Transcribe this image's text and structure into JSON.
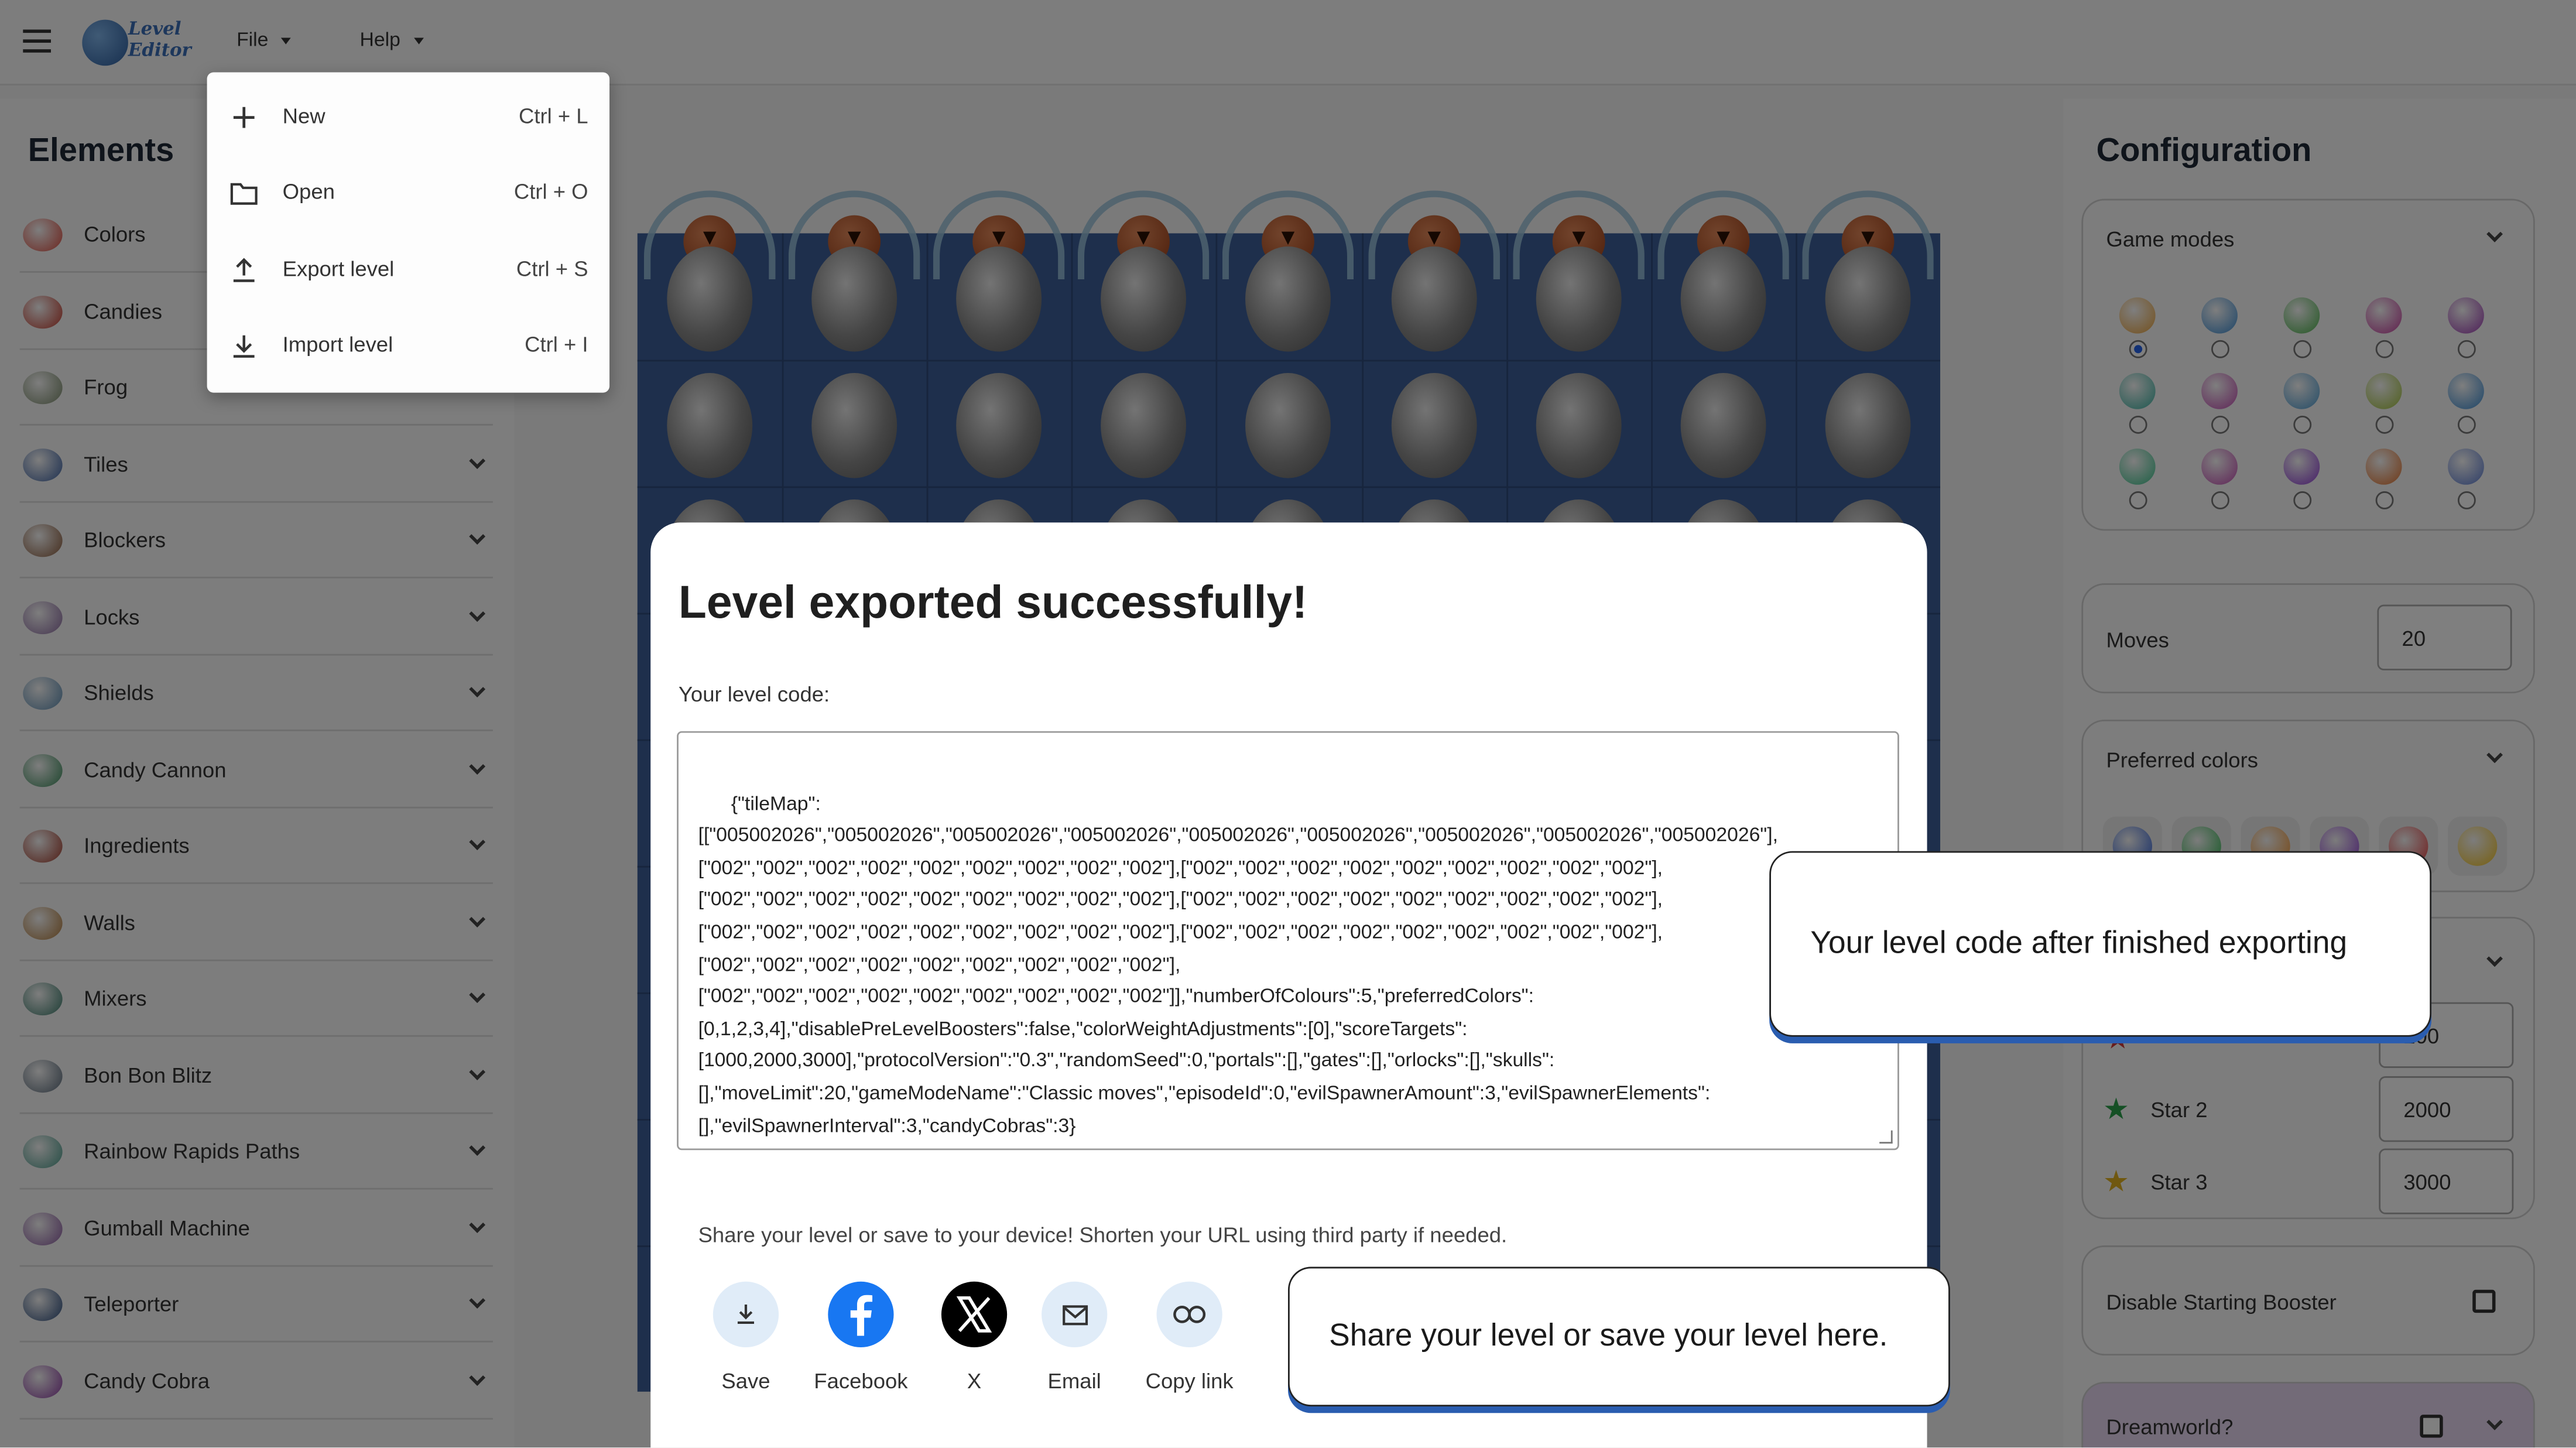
{
  "appbar": {
    "logo_text_line1": "Level",
    "logo_text_line2": "Editor",
    "file_label": "File",
    "help_label": "Help"
  },
  "elements_panel": {
    "title": "Elements",
    "items": [
      {
        "label": "Colors",
        "icon": "colors-icon",
        "color": "#d94a3d"
      },
      {
        "label": "Candies",
        "icon": "candies-icon",
        "color": "#c0392b"
      },
      {
        "label": "Frog",
        "icon": "frog-icon",
        "color": "#7a8a6a"
      },
      {
        "label": "Tiles",
        "icon": "tiles-icon",
        "color": "#3a5fa0"
      },
      {
        "label": "Blockers",
        "icon": "blockers-icon",
        "color": "#8a5a3a"
      },
      {
        "label": "Locks",
        "icon": "locks-icon",
        "color": "#8a6aa0"
      },
      {
        "label": "Shields",
        "icon": "shields-icon",
        "color": "#5a8ab0"
      },
      {
        "label": "Candy Cannon",
        "icon": "candy-cannon-icon",
        "color": "#3a8a5a"
      },
      {
        "label": "Ingredients",
        "icon": "ingredients-icon",
        "color": "#a03a2a"
      },
      {
        "label": "Walls",
        "icon": "walls-icon",
        "color": "#b07a3a"
      },
      {
        "label": "Mixers",
        "icon": "mixers-icon",
        "color": "#3a7a6a"
      },
      {
        "label": "Bon Bon Blitz",
        "icon": "bon-bon-blitz-icon",
        "color": "#5a6a7a"
      },
      {
        "label": "Rainbow Rapids Paths",
        "icon": "rainbow-rapids-icon",
        "color": "#4a9a8a"
      },
      {
        "label": "Gumball Machine",
        "icon": "gumball-machine-icon",
        "color": "#8a5aa0"
      },
      {
        "label": "Teleporter",
        "icon": "teleporter-icon",
        "color": "#2a4a7a"
      },
      {
        "label": "Candy Cobra",
        "icon": "candy-cobra-icon",
        "color": "#8a3aa0"
      }
    ]
  },
  "file_menu": {
    "items": [
      {
        "label": "New",
        "shortcut": "Ctrl + L",
        "icon": "plus-icon"
      },
      {
        "label": "Open",
        "shortcut": "Ctrl + O",
        "icon": "folder-icon"
      },
      {
        "label": "Export level",
        "shortcut": "Ctrl + S",
        "icon": "upload-icon"
      },
      {
        "label": "Import level",
        "shortcut": "Ctrl + I",
        "icon": "download-icon"
      }
    ]
  },
  "config_panel": {
    "title": "Configuration",
    "game_modes_label": "Game modes",
    "game_mode_colors": [
      "#e8a13a",
      "#3a8ad0",
      "#4ab04a",
      "#c03a9a",
      "#9a3ab0",
      "#3ab0a0",
      "#c04ab0",
      "#4a9ad0",
      "#a0c03a",
      "#3a8ad0",
      "#3ac08a",
      "#c04ab0",
      "#8a3ad0",
      "#e0702a",
      "#5a7ad0"
    ],
    "moves_label": "Moves",
    "moves_value": "20",
    "preferred_colors_label": "Preferred colors",
    "preferred_candy_colors": [
      "#2a5ad0",
      "#2ab04a",
      "#f0902a",
      "#8a3ad0",
      "#e03a3a",
      "#f0c020"
    ],
    "star1_value": "200",
    "star2_label": "Star 2",
    "star2_value": "2000",
    "star3_label": "Star 3",
    "star3_value": "3000",
    "disable_booster_label": "Disable Starting Booster",
    "dreamworld_label": "Dreamworld?"
  },
  "dialog": {
    "title": "Level exported successfully!",
    "code_label": "Your level code:",
    "code": "{\"tileMap\":\n[[\"005002026\",\"005002026\",\"005002026\",\"005002026\",\"005002026\",\"005002026\",\"005002026\",\"005002026\",\"005002026\"],\n[\"002\",\"002\",\"002\",\"002\",\"002\",\"002\",\"002\",\"002\",\"002\"],[\"002\",\"002\",\"002\",\"002\",\"002\",\"002\",\"002\",\"002\",\"002\"],\n[\"002\",\"002\",\"002\",\"002\",\"002\",\"002\",\"002\",\"002\",\"002\"],[\"002\",\"002\",\"002\",\"002\",\"002\",\"002\",\"002\",\"002\",\"002\"],\n[\"002\",\"002\",\"002\",\"002\",\"002\",\"002\",\"002\",\"002\",\"002\"],[\"002\",\"002\",\"002\",\"002\",\"002\",\"002\",\"002\",\"002\",\"002\"],\n[\"002\",\"002\",\"002\",\"002\",\"002\",\"002\",\"002\",\"002\",\"002\"],\n[\"002\",\"002\",\"002\",\"002\",\"002\",\"002\",\"002\",\"002\",\"002\"]],\"numberOfColours\":5,\"preferredColors\":\n[0,1,2,3,4],\"disablePreLevelBoosters\":false,\"colorWeightAdjustments\":[0],\"scoreTargets\":\n[1000,2000,3000],\"protocolVersion\":\"0.3\",\"randomSeed\":0,\"portals\":[],\"gates\":[],\"orlocks\":[],\"skulls\":\n[],\"moveLimit\":20,\"gameModeName\":\"Classic moves\",\"episodeId\":0,\"evilSpawnerAmount\":3,\"evilSpawnerElements\":\n[],\"evilSpawnerInterval\":3,\"candyCobras\":3}",
    "share_text": "Share your level or save to your device! Shorten your URL using third party if needed.",
    "share_buttons": [
      {
        "label": "Save",
        "icon": "download-icon"
      },
      {
        "label": "Facebook",
        "icon": "facebook-icon"
      },
      {
        "label": "X",
        "icon": "x-logo-icon"
      },
      {
        "label": "Email",
        "icon": "email-icon"
      },
      {
        "label": "Copy link",
        "icon": "link-icon"
      }
    ]
  },
  "callouts": {
    "code_tip": "Your level code after finished exporting",
    "share_tip": "Share your level or save your level here."
  },
  "colors": {
    "board_blue": "#3d5f99",
    "accent_blue": "#2a5db0",
    "facebook_blue": "#1877f2",
    "share_circle_bg": "#e0ecf8"
  }
}
